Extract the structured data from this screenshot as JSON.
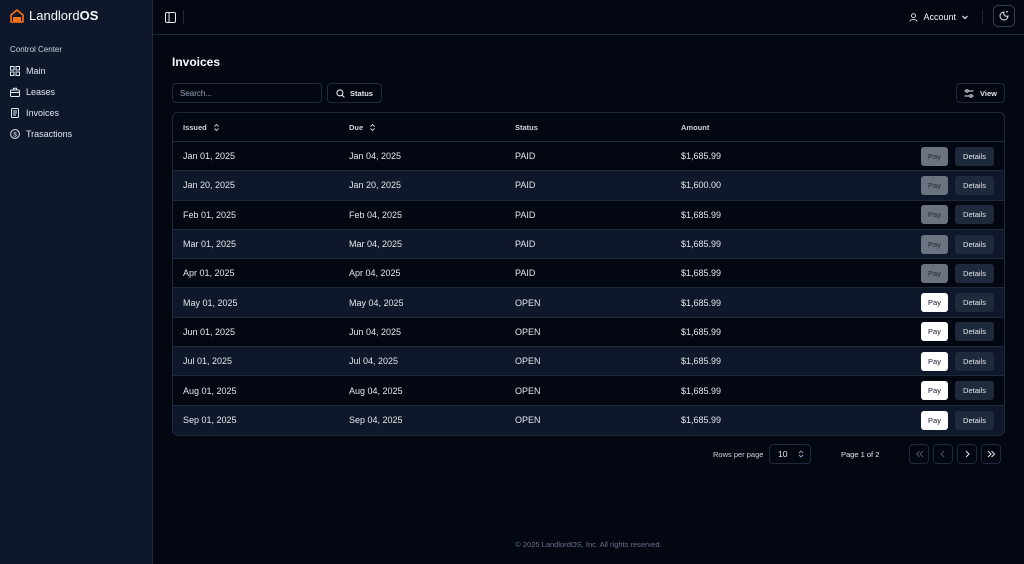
{
  "brand": {
    "name_light": "Landlord",
    "name_bold": "OS"
  },
  "sidebar": {
    "section_label": "Control Center",
    "items": [
      {
        "label": "Main",
        "icon": "grid-icon"
      },
      {
        "label": "Leases",
        "icon": "briefcase-icon"
      },
      {
        "label": "Invoices",
        "icon": "document-icon"
      },
      {
        "label": "Trasactions",
        "icon": "dollar-circle-icon"
      }
    ]
  },
  "header": {
    "account_label": "Account"
  },
  "page": {
    "title": "Invoices"
  },
  "toolbar": {
    "search_placeholder": "Search...",
    "status_label": "Status",
    "view_label": "View"
  },
  "table": {
    "columns": [
      "Issued",
      "Due",
      "Status",
      "Amount"
    ],
    "rows": [
      {
        "issued": "Jan 01, 2025",
        "due": "Jan 04, 2025",
        "status": "PAID",
        "amount": "$1,685.99",
        "pay": "Pay",
        "details": "Details"
      },
      {
        "issued": "Jan 20, 2025",
        "due": "Jan 20, 2025",
        "status": "PAID",
        "amount": "$1,600.00",
        "pay": "Pay",
        "details": "Details"
      },
      {
        "issued": "Feb 01, 2025",
        "due": "Feb 04, 2025",
        "status": "PAID",
        "amount": "$1,685.99",
        "pay": "Pay",
        "details": "Details"
      },
      {
        "issued": "Mar 01, 2025",
        "due": "Mar 04, 2025",
        "status": "PAID",
        "amount": "$1,685.99",
        "pay": "Pay",
        "details": "Details"
      },
      {
        "issued": "Apr 01, 2025",
        "due": "Apr 04, 2025",
        "status": "PAID",
        "amount": "$1,685.99",
        "pay": "Pay",
        "details": "Details"
      },
      {
        "issued": "May 01, 2025",
        "due": "May 04, 2025",
        "status": "OPEN",
        "amount": "$1,685.99",
        "pay": "Pay",
        "details": "Details"
      },
      {
        "issued": "Jun 01, 2025",
        "due": "Jun 04, 2025",
        "status": "OPEN",
        "amount": "$1,685.99",
        "pay": "Pay",
        "details": "Details"
      },
      {
        "issued": "Jul 01, 2025",
        "due": "Jul 04, 2025",
        "status": "OPEN",
        "amount": "$1,685.99",
        "pay": "Pay",
        "details": "Details"
      },
      {
        "issued": "Aug 01, 2025",
        "due": "Aug 04, 2025",
        "status": "OPEN",
        "amount": "$1,685.99",
        "pay": "Pay",
        "details": "Details"
      },
      {
        "issued": "Sep 01, 2025",
        "due": "Sep 04, 2025",
        "status": "OPEN",
        "amount": "$1,685.99",
        "pay": "Pay",
        "details": "Details"
      }
    ]
  },
  "pagination": {
    "rows_per_page_label": "Rows per page",
    "rows_per_page_value": "10",
    "page_info": "Page 1 of 2"
  },
  "footer": {
    "text": "© 2025 LandlordOS, Inc. All rights reserved."
  },
  "colors": {
    "accent": "#f97316",
    "background": "#030712",
    "sidebar": "#0f172a",
    "border": "#1e293b"
  }
}
